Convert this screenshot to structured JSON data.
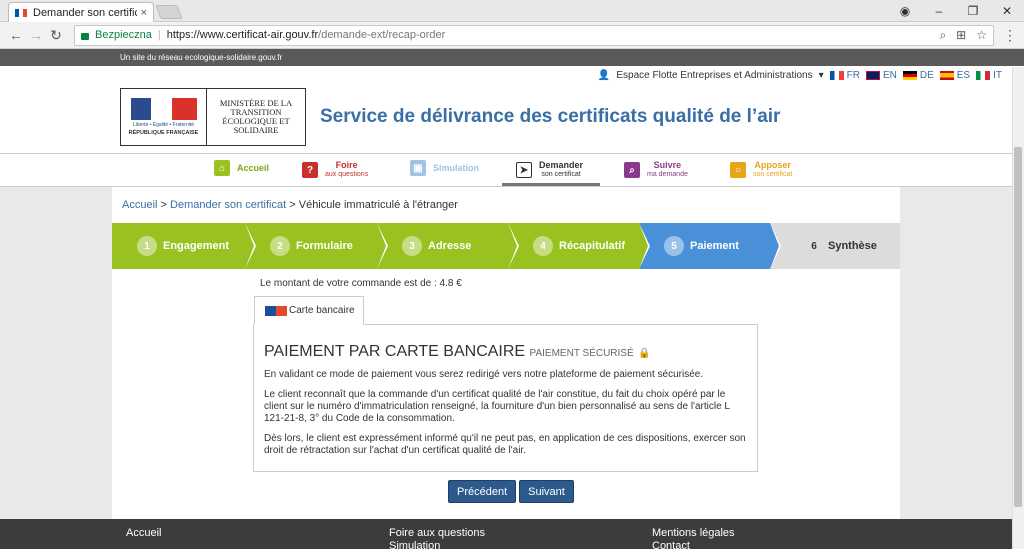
{
  "browser": {
    "tab_title": "Demander son certificat",
    "tab_close": "×",
    "secure_label": "Bezpieczna",
    "url_host": "https://www.certificat-air.gouv.fr",
    "url_path": "/demande-ext/recap-order"
  },
  "topstrip": {
    "text": "Un site du réseau ecologique-solidaire.gouv.fr"
  },
  "header": {
    "espace": "Espace Flotte Entreprises et Administrations",
    "languages": [
      {
        "code": "FR",
        "color": "#0055a4"
      },
      {
        "code": "EN",
        "color": "#012169"
      },
      {
        "code": "DE",
        "color": "#000000"
      },
      {
        "code": "ES",
        "color": "#c60b1e"
      },
      {
        "code": "IT",
        "color": "#009246"
      }
    ],
    "logo_ministry": "MINISTÈRE DE LA TRANSITION ÉCOLOGIQUE ET SOLIDAIRE",
    "logo_motto": "Liberté • Égalité • Fraternité",
    "logo_rf": "RÉPUBLIQUE FRANÇAISE",
    "site_title": "Service de délivrance des certificats qualité de l’air"
  },
  "nav": [
    {
      "label": "Accueil",
      "sub": "",
      "color": "#99c221"
    },
    {
      "label": "Foire",
      "sub": "aux questions",
      "color": "#c8302c"
    },
    {
      "label": "Simulation",
      "sub": "",
      "color": "#9fc3e3"
    },
    {
      "label": "Demander",
      "sub": "son certificat",
      "color": "#333333"
    },
    {
      "label": "Suivre",
      "sub": "ma demande",
      "color": "#8b3a8b"
    },
    {
      "label": "Apposer",
      "sub": "son certificat",
      "color": "#e8a317"
    }
  ],
  "breadcrumb": {
    "home": "Accueil",
    "request": "Demander son certificat",
    "current": "Véhicule immatriculé à l'étranger"
  },
  "steps": [
    {
      "num": "1",
      "label": "Engagement",
      "state": "done"
    },
    {
      "num": "2",
      "label": "Formulaire",
      "state": "done"
    },
    {
      "num": "3",
      "label": "Adresse",
      "state": "done"
    },
    {
      "num": "4",
      "label": "Récapitulatif",
      "state": "done"
    },
    {
      "num": "5",
      "label": "Paiement",
      "state": "current"
    },
    {
      "num": "6",
      "label": "Synthèse",
      "state": "todo"
    }
  ],
  "payment": {
    "amount_text": "Le montant de votre commande est de : 4.8 €",
    "tab_label": "Carte bancaire",
    "title": "PAIEMENT PAR CARTE BANCAIRE",
    "secure": "Paiement sécurisé",
    "p1": "En validant ce mode de paiement vous serez redirigé vers notre plateforme de paiement sécurisée.",
    "p2": "Le client reconnaît que la commande d'un certificat qualité de l'air constitue, du fait du choix opéré par le client sur le numéro d'immatriculation renseigné, la fourniture d'un bien personnalisé au sens de l'article L 121-21-8, 3° du Code de la consommation.",
    "p3": "Dès lors, le client est expressément informé qu'il ne peut pas, en application de ces dispositions, exercer son droit de rétractation sur l'achat d'un certificat qualité de l'air."
  },
  "buttons": {
    "prev": "Précédent",
    "next": "Suivant"
  },
  "footer": {
    "col1": [
      "Accueil"
    ],
    "col2": [
      "Foire aux questions",
      "Simulation"
    ],
    "col3": [
      "Mentions légales",
      "Contact"
    ]
  }
}
